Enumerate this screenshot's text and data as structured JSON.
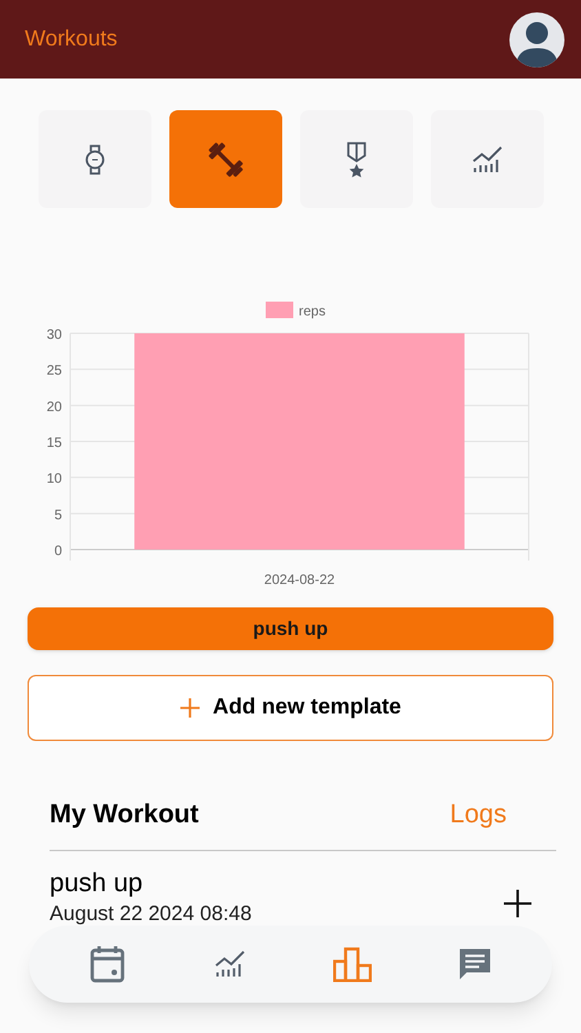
{
  "header": {
    "title": "Workouts"
  },
  "tabs": [
    {
      "kind": "watch",
      "selected": false
    },
    {
      "kind": "dumbbell",
      "selected": true
    },
    {
      "kind": "medal",
      "selected": false
    },
    {
      "kind": "trend",
      "selected": false
    }
  ],
  "chart_data": {
    "type": "bar",
    "categories": [
      "2024-08-22"
    ],
    "series": [
      {
        "name": "reps",
        "color": "#ff9fb3",
        "values": [
          30
        ]
      }
    ],
    "ylim": [
      0,
      30
    ],
    "grid": true,
    "yticks": [
      0,
      5,
      10,
      15,
      20,
      25,
      30
    ]
  },
  "exercise_button": "push up",
  "add_template_button": "Add new template",
  "section": {
    "title": "My Workout",
    "link": "Logs"
  },
  "workouts": [
    {
      "name": "push up",
      "date": "August 22 2024 08:48"
    }
  ],
  "nav": [
    {
      "kind": "calendar",
      "selected": false
    },
    {
      "kind": "trend",
      "selected": false
    },
    {
      "kind": "podium",
      "selected": true
    },
    {
      "kind": "chat",
      "selected": false
    }
  ]
}
